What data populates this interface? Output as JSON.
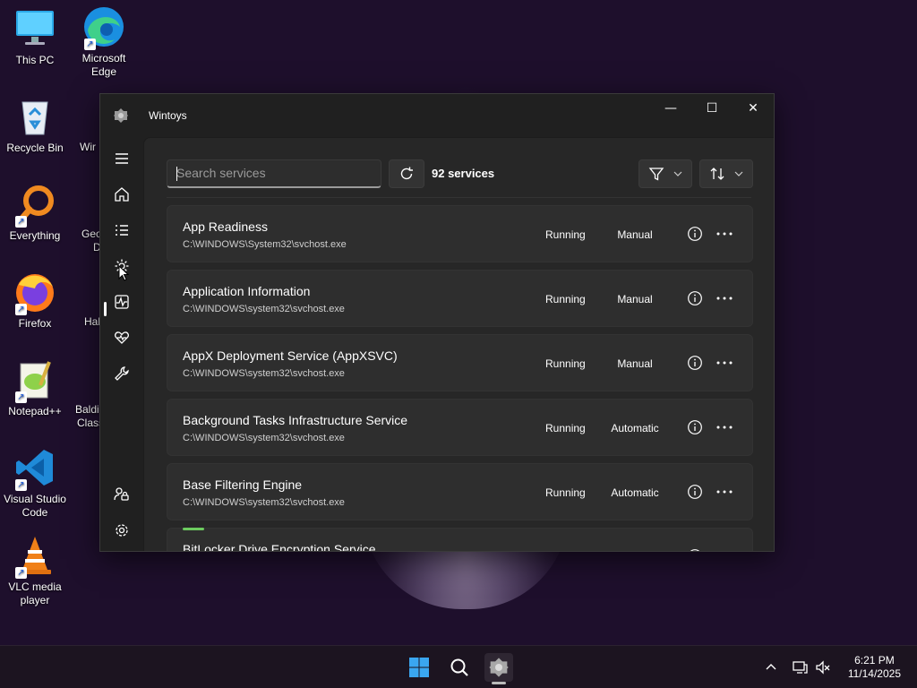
{
  "desktop": {
    "icons": [
      {
        "label": "This PC",
        "icon": "monitor-icon"
      },
      {
        "label": "Microsoft Edge",
        "icon": "edge-icon"
      },
      {
        "label": "Recycle Bin",
        "icon": "recycle-bin-icon"
      },
      {
        "label": "Everything",
        "icon": "everything-search-icon"
      },
      {
        "label": "Firefox",
        "icon": "firefox-icon"
      },
      {
        "label": "Notepad++",
        "icon": "notepad-plus-plus-icon"
      },
      {
        "label": "Visual Studio Code",
        "icon": "vscode-icon"
      },
      {
        "label": "VLC media player",
        "icon": "vlc-icon"
      }
    ],
    "partial_labels": [
      "Wir",
      "Geo",
      "D",
      "Hal",
      "Baldi'",
      "Class"
    ]
  },
  "window": {
    "title": "Wintoys",
    "controls": {
      "minimize": "—",
      "maximize": "☐",
      "close": "✕"
    }
  },
  "nav": {
    "items": [
      "menu-icon",
      "home-icon",
      "list-icon",
      "services-gear-icon",
      "performance-icon",
      "health-icon",
      "tools-wrench-icon",
      "account-icon",
      "settings-icon"
    ],
    "active": "services-gear-icon"
  },
  "toolbar": {
    "search_placeholder": "Search services",
    "count_label": "92 services"
  },
  "services": [
    {
      "name": "App Readiness",
      "path": "C:\\WINDOWS\\System32\\svchost.exe",
      "status": "Running",
      "startup": "Manual"
    },
    {
      "name": "Application Information",
      "path": "C:\\WINDOWS\\system32\\svchost.exe",
      "status": "Running",
      "startup": "Manual"
    },
    {
      "name": "AppX Deployment Service (AppXSVC)",
      "path": "C:\\WINDOWS\\system32\\svchost.exe",
      "status": "Running",
      "startup": "Manual"
    },
    {
      "name": "Background Tasks Infrastructure Service",
      "path": "C:\\WINDOWS\\system32\\svchost.exe",
      "status": "Running",
      "startup": "Automatic"
    },
    {
      "name": "Base Filtering Engine",
      "path": "C:\\WINDOWS\\system32\\svchost.exe",
      "status": "Running",
      "startup": "Automatic"
    },
    {
      "name": "BitLocker Drive Encryption Service",
      "path": "",
      "status": "",
      "startup": ""
    }
  ],
  "taskbar": {
    "time": "6:21 PM",
    "date": "11/14/2025"
  },
  "colors": {
    "accent": "#6ccb5f",
    "window_bg": "#202020",
    "card_bg": "#2e2e2e",
    "desktop_bg": "#1e0f2c"
  }
}
